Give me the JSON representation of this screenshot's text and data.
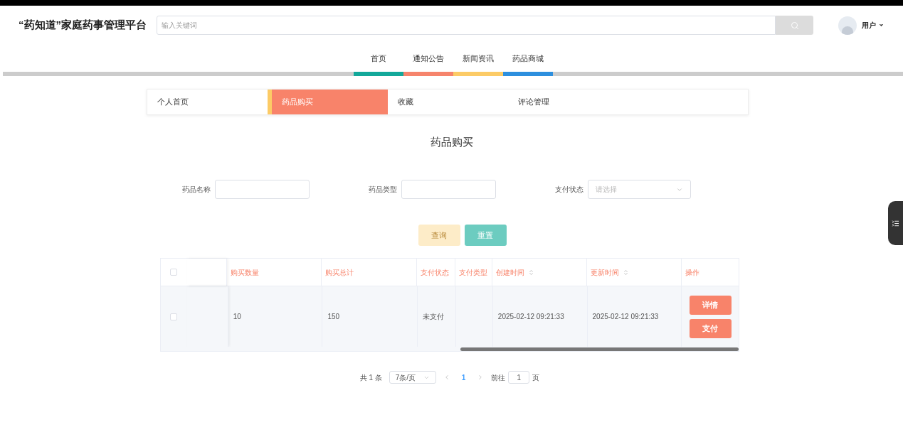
{
  "header": {
    "logo": "“药知道”家庭药事管理平台",
    "search": {
      "placeholder": "输入关键词"
    },
    "user": "用户"
  },
  "nav": [
    {
      "label": "首页",
      "color": "#13a89a"
    },
    {
      "label": "通知公告",
      "color": "#f6846c"
    },
    {
      "label": "新闻资讯",
      "color": "#fccb66"
    },
    {
      "label": "药品商城",
      "color": "#2d8fde"
    }
  ],
  "subtabs": [
    {
      "label": "个人首页",
      "selected": false
    },
    {
      "label": "药品购买",
      "selected": true
    },
    {
      "label": "收藏",
      "selected": false
    },
    {
      "label": "评论管理",
      "selected": false
    }
  ],
  "page_title": "药品购买",
  "filters": [
    {
      "label": "药品名称",
      "kind": "input"
    },
    {
      "label": "药品类型",
      "kind": "input"
    },
    {
      "label": "支付状态",
      "kind": "select",
      "placeholder": "请选择"
    }
  ],
  "buttons": [
    {
      "label": "查询",
      "color": "#fdecc8"
    },
    {
      "label": "重置",
      "color": "#6cccc0"
    }
  ],
  "table": {
    "header_checked": false,
    "columns": [
      {
        "label": "购买数量",
        "sortable": false
      },
      {
        "label": "购买总计",
        "sortable": false
      },
      {
        "label": "支付状态",
        "sortable": false
      },
      {
        "label": "支付类型",
        "sortable": false
      },
      {
        "label": "创建时间",
        "sortable": true
      },
      {
        "label": "更新时间",
        "sortable": true
      },
      {
        "label": "操作",
        "sortable": false
      }
    ],
    "rows": [
      {
        "checked": false,
        "cells": [
          "10",
          "150",
          "未支付",
          "",
          "2025-02-12 09:21:33",
          "2025-02-12 09:21:33"
        ],
        "actions": [
          "详情",
          "支付"
        ]
      }
    ]
  },
  "pagination": {
    "total": "共 1 条",
    "page_size": "7条/页",
    "pages": [
      {
        "label": "1",
        "selected": true
      }
    ],
    "goto": "前往",
    "goto_value": "1",
    "page_suffix": "页"
  }
}
